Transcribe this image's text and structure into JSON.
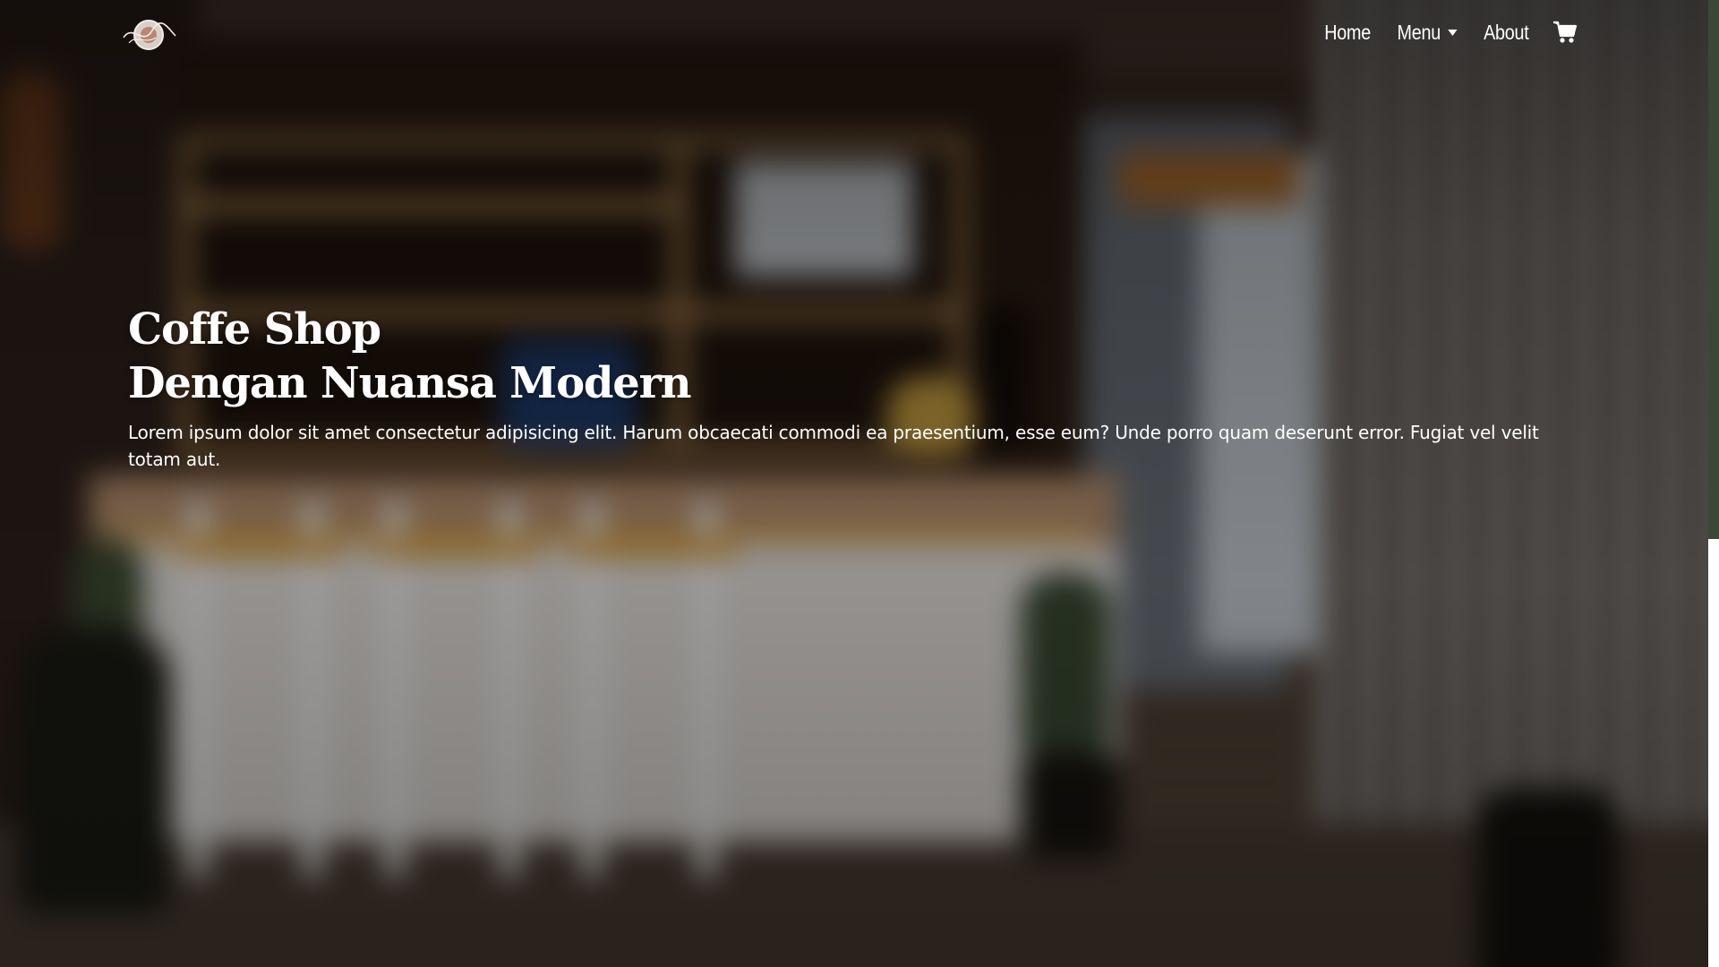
{
  "navbar": {
    "logo": "coffee-shop-logo",
    "links": [
      {
        "label": "Home"
      },
      {
        "label": "Menu"
      },
      {
        "label": "About"
      }
    ],
    "cart_icon": "shopping-cart-icon"
  },
  "hero": {
    "title_line1": "Coffe Shop",
    "title_line2": "Dengan Nuansa Modern",
    "description": "Lorem ipsum dolor sit amet consectetur adipisicing elit. Harum obcaecati commodi ea praesentium, esse eum? Unde porro quam deserunt error. Fugiat vel velit totam aut."
  },
  "colors": {
    "text": "#ffffff",
    "scrollbar_track": "#3a4838",
    "scrollbar_thumb": "#ffffff"
  }
}
